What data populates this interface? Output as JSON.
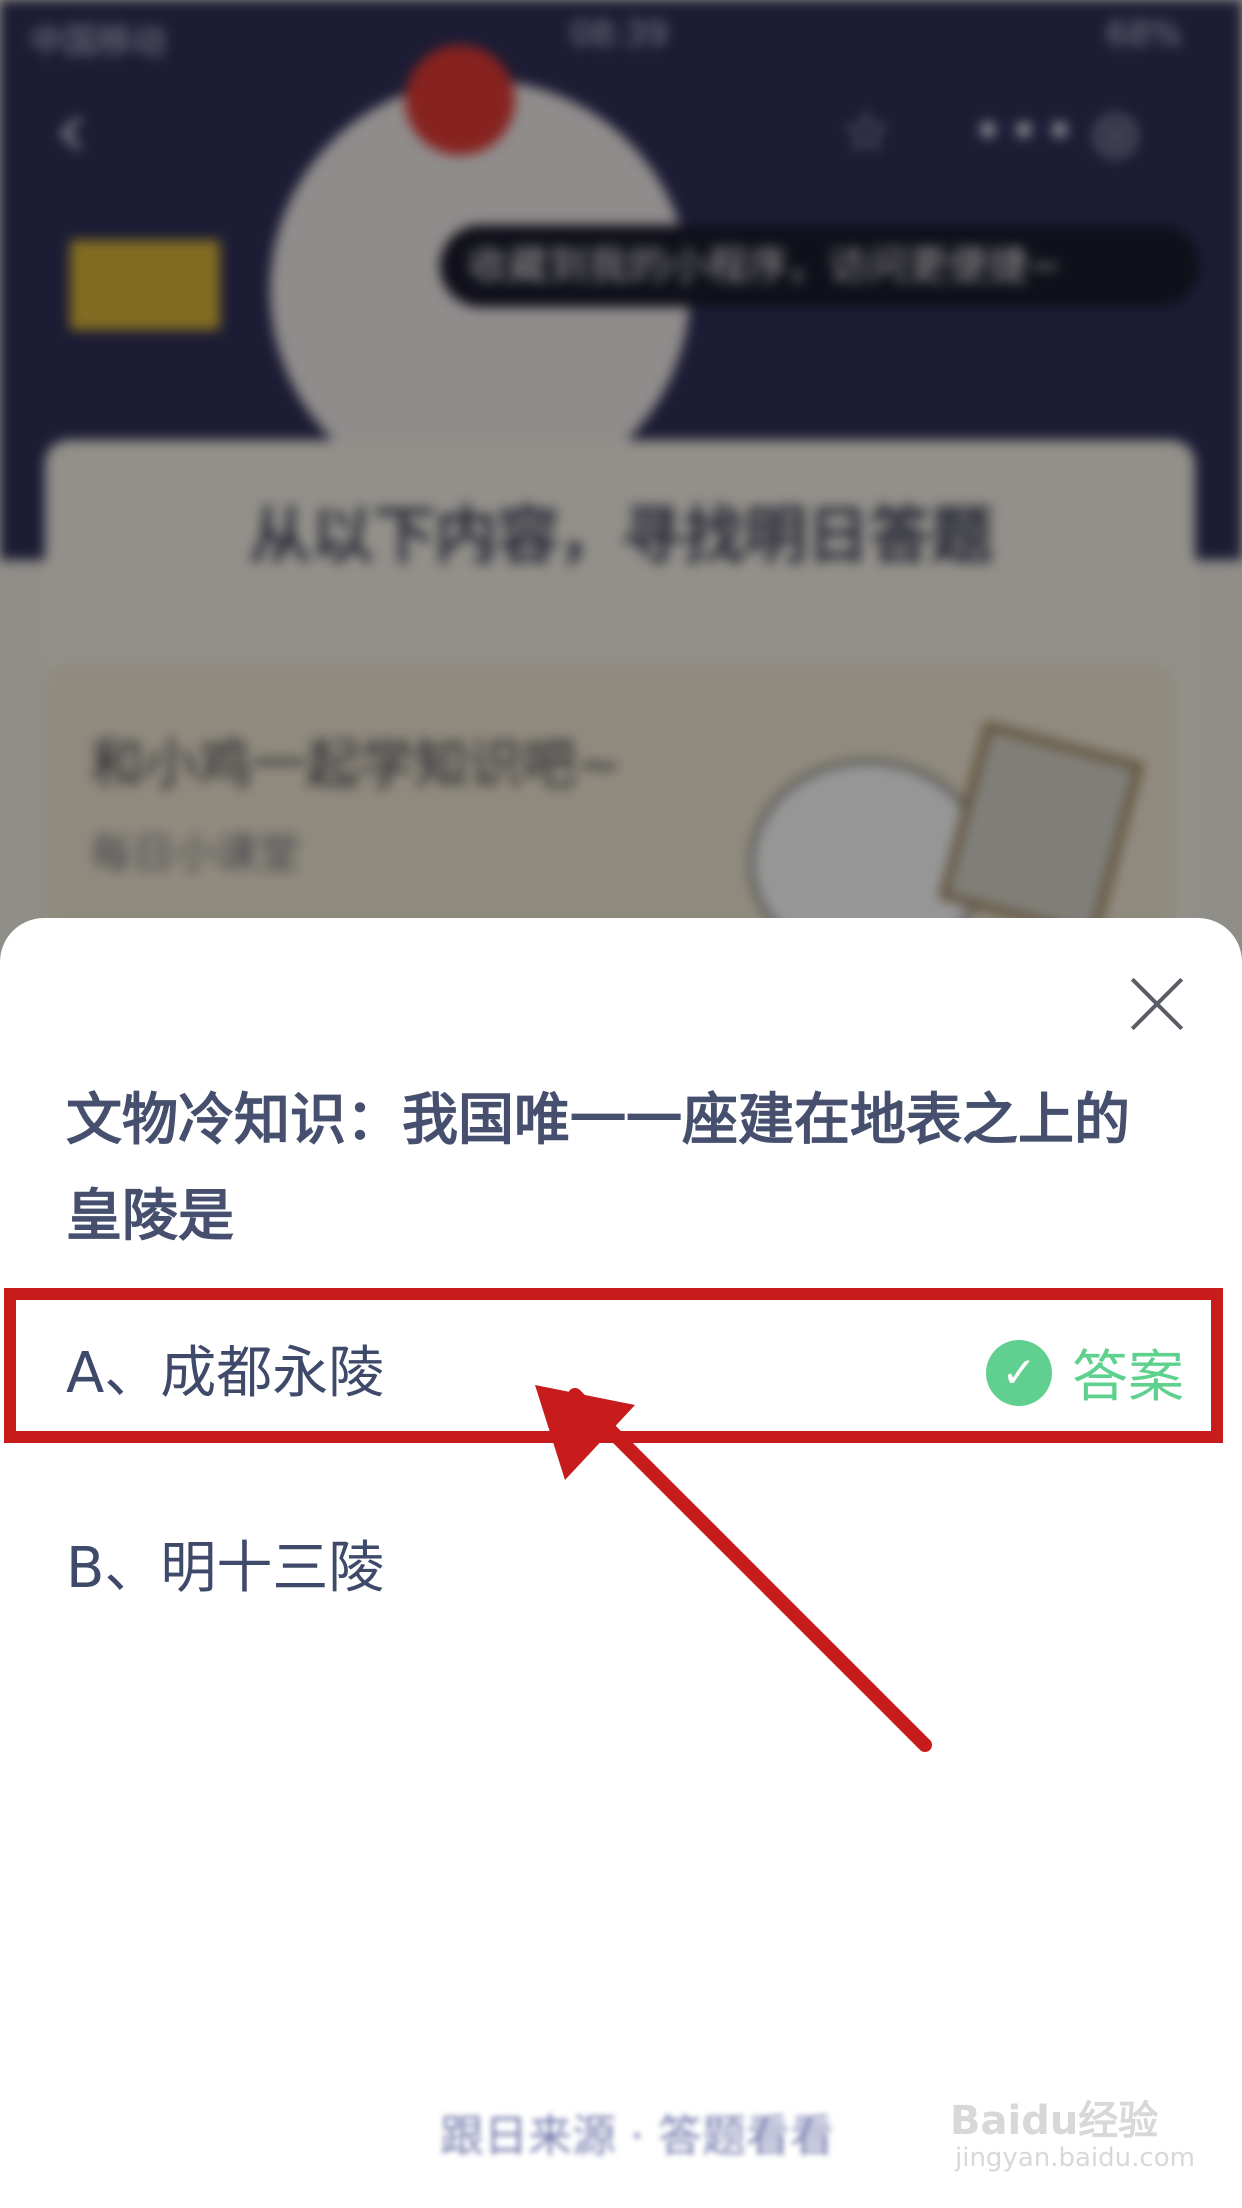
{
  "status_bar": {
    "carrier": "中国移动",
    "time": "08:39",
    "battery": "68%"
  },
  "background": {
    "toast": "收藏到我的小程序，访问更便捷~",
    "heading": "从以下内容，寻找明日答题",
    "card_title": "和小鸡一起学知识吧~",
    "card_subtitle": "每日小课堂"
  },
  "quiz": {
    "question": "文物冷知识：我国唯一一座建在地表之上的皇陵是",
    "options": [
      {
        "label": "A、成都永陵",
        "is_answer": true
      },
      {
        "label": "B、明十三陵",
        "is_answer": false
      }
    ],
    "answer_tag": "答案",
    "bottom_link": "跟日来源 · 答题看看"
  },
  "watermark": {
    "logo": "Baidu经验",
    "url": "jingyan.baidu.com"
  },
  "colors": {
    "question": "#46506e",
    "answer_green": "#5fd18e",
    "highlight_red": "#c81b1c"
  },
  "icons": [
    "back-icon",
    "star-icon",
    "more-icon",
    "target-icon",
    "close-icon",
    "check-icon"
  ]
}
